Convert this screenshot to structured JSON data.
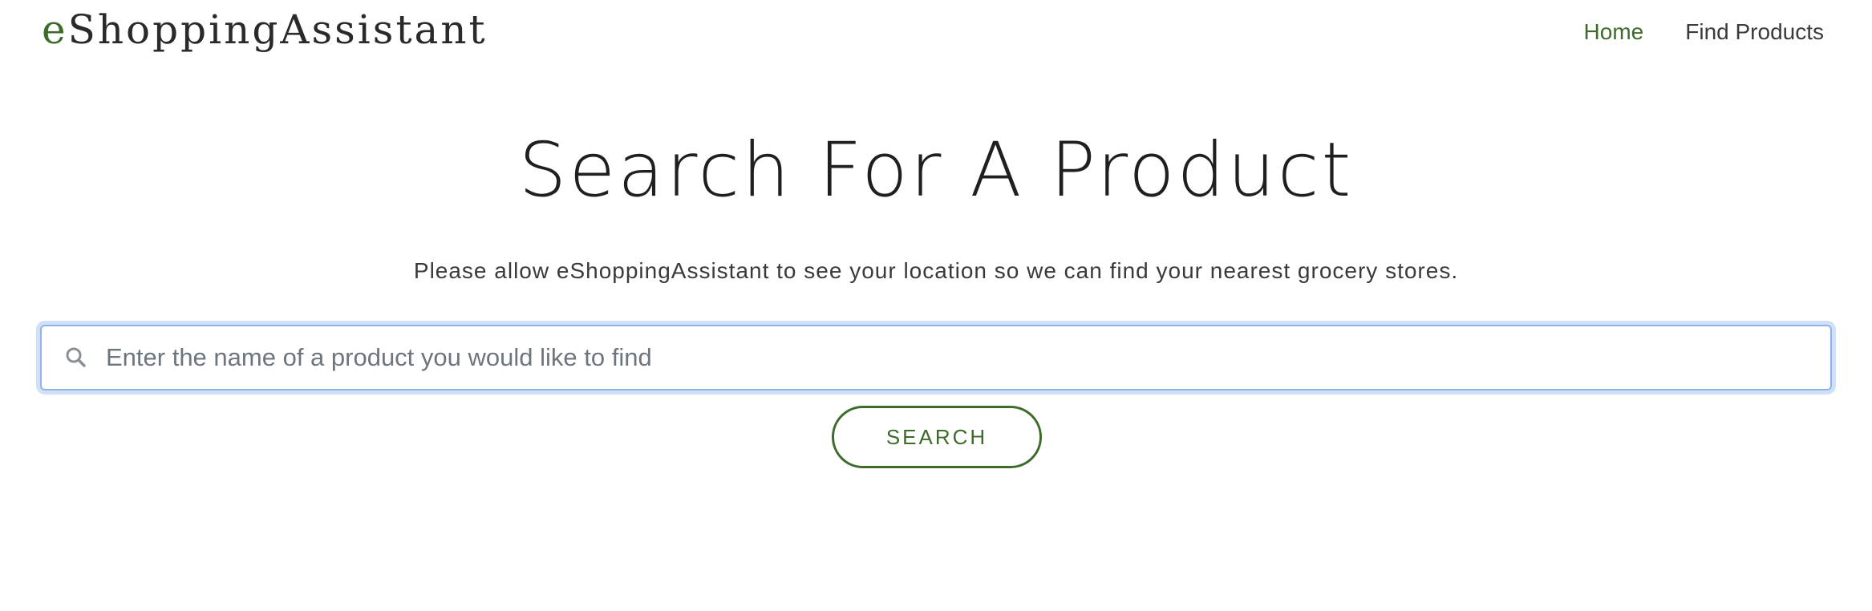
{
  "header": {
    "brand_prefix": "e",
    "brand_rest": "ShoppingAssistant",
    "nav": [
      {
        "label": "Home",
        "active": true
      },
      {
        "label": "Find Products",
        "active": false
      }
    ]
  },
  "main": {
    "title": "Search For A Product",
    "subtitle": "Please allow eShoppingAssistant to see your location so we can find your nearest grocery stores.",
    "search": {
      "icon": "search-icon",
      "placeholder": "Enter the name of a product you would like to find",
      "value": ""
    },
    "search_button_label": "SEARCH"
  },
  "colors": {
    "accent": "#3d6b2a",
    "focus_ring": "#cfe0f8",
    "text": "#333333"
  }
}
